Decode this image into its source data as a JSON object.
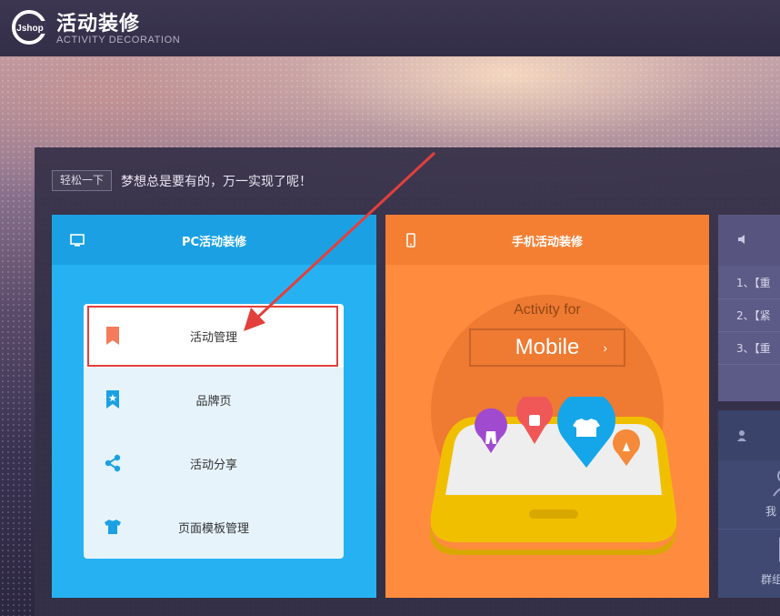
{
  "header": {
    "logo_text": "Jshop",
    "title_cn": "活动装修",
    "title_en": "ACTIVITY DECORATION"
  },
  "intro": {
    "tag_button": "轻松一下",
    "tagline": "梦想总是要有的，万一实现了呢！"
  },
  "pc_card": {
    "title": "PC活动装修",
    "items": [
      {
        "label": "活动管理",
        "icon": "bookmark-icon"
      },
      {
        "label": "品牌页",
        "icon": "star-bookmark-icon"
      },
      {
        "label": "活动分享",
        "icon": "share-icon"
      },
      {
        "label": "页面模板管理",
        "icon": "tshirt-icon"
      }
    ]
  },
  "mobile_card": {
    "title": "手机活动装修",
    "subtitle": "Activity for",
    "button": "Mobile",
    "button_chevron": "›"
  },
  "news_card": {
    "items": [
      "1、【重",
      "2、【紧",
      "3、【重"
    ]
  },
  "user_card": {
    "items": [
      "我",
      "群组"
    ]
  },
  "colors": {
    "pc_accent": "#26b2f2",
    "mobile_accent": "#ff8b3e",
    "highlight": "#e2403c"
  }
}
